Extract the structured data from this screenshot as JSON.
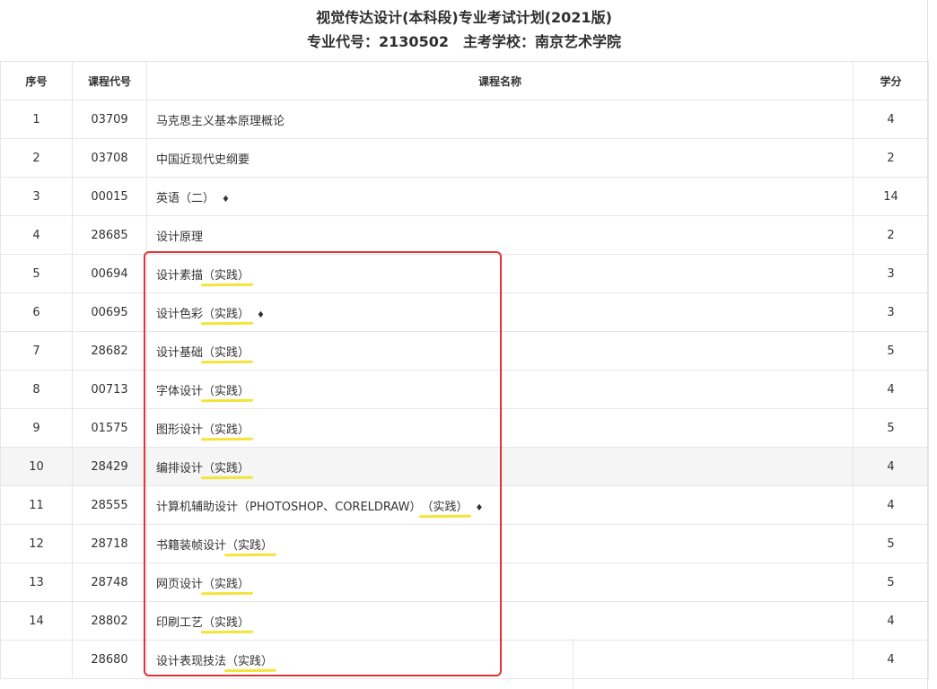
{
  "header": {
    "title": "视觉传达设计(本科段)专业考试计划(2021版)",
    "subtitle": "专业代号：2130502　主考学校：南京艺术学院"
  },
  "table": {
    "headers": [
      "序号",
      "课程代号",
      "课程名称",
      "学分"
    ],
    "rows": [
      {
        "no": "1",
        "code": "03709",
        "name": "马克思主义基本原理概论",
        "note": "",
        "mark": "",
        "credit": "4"
      },
      {
        "no": "2",
        "code": "03708",
        "name": "中国近现代史纲要",
        "note": "",
        "mark": "",
        "credit": "2"
      },
      {
        "no": "3",
        "code": "00015",
        "name": "英语（二）",
        "note": "",
        "mark": "♦",
        "credit": "14"
      },
      {
        "no": "4",
        "code": "28685",
        "name": "设计原理",
        "note": "",
        "mark": "",
        "credit": "2"
      },
      {
        "no": "5",
        "code": "00694",
        "name": "设计素描",
        "note": "（实践）",
        "mark": "",
        "credit": "3"
      },
      {
        "no": "6",
        "code": "00695",
        "name": "设计色彩",
        "note": "（实践）",
        "mark": "♦",
        "credit": "3"
      },
      {
        "no": "7",
        "code": "28682",
        "name": "设计基础",
        "note": "（实践）",
        "mark": "",
        "credit": "5"
      },
      {
        "no": "8",
        "code": "00713",
        "name": "字体设计",
        "note": "（实践）",
        "mark": "",
        "credit": "4"
      },
      {
        "no": "9",
        "code": "01575",
        "name": "图形设计",
        "note": "（实践）",
        "mark": "",
        "credit": "5"
      },
      {
        "no": "10",
        "code": "28429",
        "name": "编排设计",
        "note": "（实践）",
        "mark": "",
        "credit": "4"
      },
      {
        "no": "11",
        "code": "28555",
        "name": "计算机辅助设计（PHOTOSHOP、CORELDRAW）",
        "note": "（实践）",
        "mark": "♦",
        "credit": "4"
      },
      {
        "no": "12",
        "code": "28718",
        "name": "书籍装帧设计",
        "note": "（实践）",
        "mark": "",
        "credit": "5"
      },
      {
        "no": "13",
        "code": "28748",
        "name": "网页设计",
        "note": "（实践）",
        "mark": "",
        "credit": "5"
      },
      {
        "no": "14",
        "code": "28802",
        "name": "印刷工艺",
        "note": "（实践）",
        "mark": "",
        "credit": "4"
      },
      {
        "no": "",
        "code": "28680",
        "name": "设计表现技法",
        "note": "（实践）",
        "mark": "",
        "credit": "4"
      }
    ]
  },
  "colors": {
    "annotation_box": "#e0343b",
    "underline": "#f3e43a",
    "row_highlight": "#f5f5f5",
    "grid": "#e6e6e6"
  }
}
